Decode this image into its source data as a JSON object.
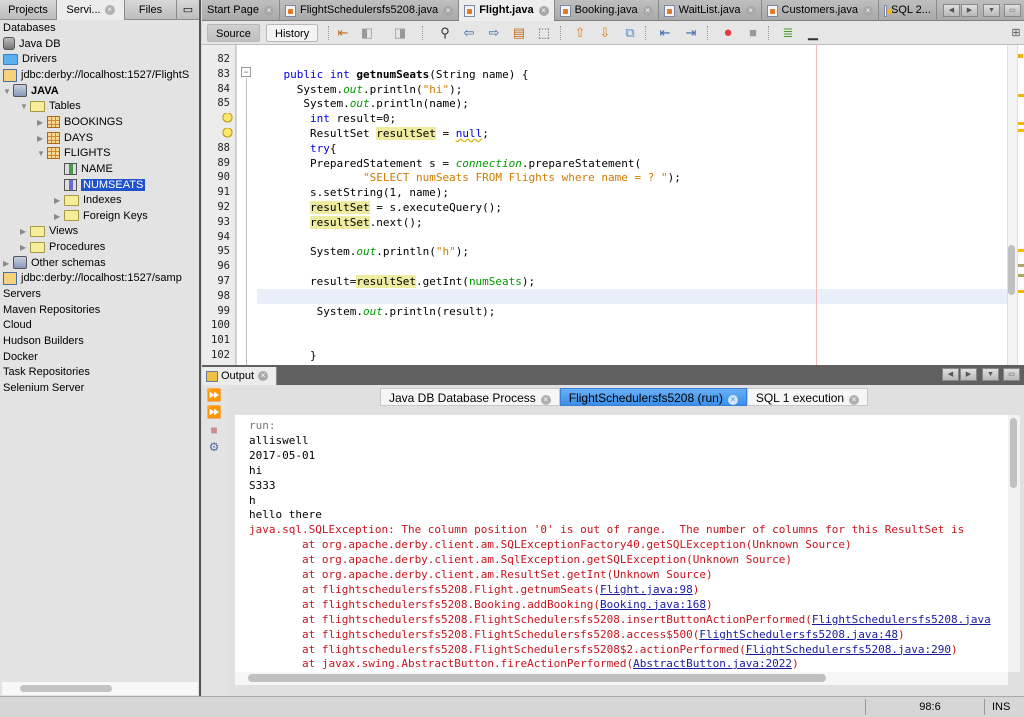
{
  "left_panel": {
    "tabs": [
      {
        "label": "Projects",
        "active": false
      },
      {
        "label": "Servi...",
        "active": true,
        "closable": true
      },
      {
        "label": "Files",
        "active": false
      }
    ],
    "minimize_icon": "window-minimize-icon",
    "tree": [
      {
        "label": "Databases",
        "level": 0,
        "icon": "none"
      },
      {
        "label": "Java DB",
        "level": 0,
        "icon": "database-server-icon"
      },
      {
        "label": "Drivers",
        "level": 0,
        "icon": "folder-icon"
      },
      {
        "label": "jdbc:derby://localhost:1527/FlightS",
        "level": 0,
        "icon": "connection-icon"
      },
      {
        "label": "JAVA",
        "level": 0,
        "icon": "schema-icon",
        "expanded": true,
        "bold": true
      },
      {
        "label": "Tables",
        "level": 1,
        "icon": "folder-icon",
        "expanded": true
      },
      {
        "label": "BOOKINGS",
        "level": 2,
        "icon": "table-icon",
        "expanded": false
      },
      {
        "label": "DAYS",
        "level": 2,
        "icon": "table-icon",
        "expanded": false
      },
      {
        "label": "FLIGHTS",
        "level": 2,
        "icon": "table-icon",
        "expanded": true
      },
      {
        "label": "NAME",
        "level": 3,
        "icon": "column-icon"
      },
      {
        "label": "NUMSEATS",
        "level": 3,
        "icon": "column-icon",
        "selected": true
      },
      {
        "label": "Indexes",
        "level": 3,
        "icon": "folder-icon",
        "expanded": false
      },
      {
        "label": "Foreign Keys",
        "level": 3,
        "icon": "folder-icon",
        "expanded": false
      },
      {
        "label": "Views",
        "level": 1,
        "icon": "folder-icon",
        "expanded": false
      },
      {
        "label": "Procedures",
        "level": 1,
        "icon": "folder-icon",
        "expanded": false
      },
      {
        "label": "Other schemas",
        "level": 0,
        "icon": "schema-icon",
        "expanded": false
      },
      {
        "label": "jdbc:derby://localhost:1527/samp",
        "level": 0,
        "icon": "connection-icon"
      },
      {
        "label": "Servers",
        "level": 0,
        "icon": "none"
      },
      {
        "label": "Maven Repositories",
        "level": 0,
        "icon": "none"
      },
      {
        "label": "Cloud",
        "level": 0,
        "icon": "none"
      },
      {
        "label": "Hudson Builders",
        "level": 0,
        "icon": "none"
      },
      {
        "label": "Docker",
        "level": 0,
        "icon": "none"
      },
      {
        "label": "Task Repositories",
        "level": 0,
        "icon": "none"
      },
      {
        "label": "Selenium Server",
        "level": 0,
        "icon": "none"
      }
    ]
  },
  "editor": {
    "tabs": [
      {
        "label": "Start Page",
        "active": false,
        "icon": "none"
      },
      {
        "label": "FlightSchedulersfs5208.java",
        "active": false,
        "icon": "java-file-icon"
      },
      {
        "label": "Flight.java",
        "active": true,
        "icon": "java-file-icon"
      },
      {
        "label": "Booking.java",
        "active": false,
        "icon": "java-file-icon"
      },
      {
        "label": "WaitList.java",
        "active": false,
        "icon": "java-file-icon"
      },
      {
        "label": "Customers.java",
        "active": false,
        "icon": "java-file-icon"
      },
      {
        "label": "SQL 2...",
        "active": false,
        "icon": "sql-file-icon"
      }
    ],
    "toolbar": {
      "source_label": "Source",
      "history_label": "History",
      "icons": [
        "last-edit-icon",
        "back-icon",
        "forward-icon",
        "find-icon",
        "find-previous-icon",
        "find-next-icon",
        "toggle-highlight-icon",
        "rectangular-selection-icon",
        "previous-bookmark-icon",
        "next-bookmark-icon",
        "toggle-bookmark-icon",
        "shift-left-icon",
        "shift-right-icon",
        "start-macro-icon",
        "stop-macro-icon",
        "comment-icon",
        "uncomment-icon"
      ],
      "split_icon": "split-window-icon"
    },
    "lines": [
      {
        "num": "82",
        "tokens": []
      },
      {
        "num": "83",
        "tokens": [
          {
            "t": "    "
          },
          {
            "t": "public int",
            "c": "kw"
          },
          {
            "t": " "
          },
          {
            "t": "getnumSeats",
            "c": "fn"
          },
          {
            "t": "(String name) {"
          }
        ]
      },
      {
        "num": "84",
        "tokens": [
          {
            "t": "      System."
          },
          {
            "t": "out",
            "c": "it"
          },
          {
            "t": ".println("
          },
          {
            "t": "\"hi\"",
            "c": "str"
          },
          {
            "t": ");"
          }
        ]
      },
      {
        "num": "85",
        "tokens": [
          {
            "t": "       System."
          },
          {
            "t": "out",
            "c": "it"
          },
          {
            "t": ".println(name);"
          }
        ]
      },
      {
        "num": "",
        "bulb": true,
        "tokens": [
          {
            "t": "        "
          },
          {
            "t": "int",
            "c": "kw"
          },
          {
            "t": " result=0;"
          }
        ]
      },
      {
        "num": "",
        "bulb": true,
        "tokens": [
          {
            "t": "        ResultSet "
          },
          {
            "t": "resultSet",
            "c": "hl"
          },
          {
            "t": " = "
          },
          {
            "t": "null",
            "c": "nul"
          },
          {
            "t": ";"
          }
        ]
      },
      {
        "num": "88",
        "tokens": [
          {
            "t": "        "
          },
          {
            "t": "try",
            "c": "kw"
          },
          {
            "t": "{"
          }
        ]
      },
      {
        "num": "89",
        "tokens": [
          {
            "t": "        PreparedStatement s = "
          },
          {
            "t": "connection",
            "c": "it"
          },
          {
            "t": ".prepareStatement("
          }
        ]
      },
      {
        "num": "90",
        "tokens": [
          {
            "t": "                "
          },
          {
            "t": "\"SELECT numSeats FROM Flights where name = ? \"",
            "c": "str"
          },
          {
            "t": ");"
          }
        ]
      },
      {
        "num": "91",
        "tokens": [
          {
            "t": "        s.setString(1, name);"
          }
        ]
      },
      {
        "num": "92",
        "tokens": [
          {
            "t": "        "
          },
          {
            "t": "resultSet",
            "c": "hl"
          },
          {
            "t": " = s.executeQuery();"
          }
        ]
      },
      {
        "num": "93",
        "tokens": [
          {
            "t": "        "
          },
          {
            "t": "resultSet",
            "c": "hl"
          },
          {
            "t": ".next();"
          }
        ]
      },
      {
        "num": "94",
        "tokens": []
      },
      {
        "num": "95",
        "tokens": [
          {
            "t": "        System."
          },
          {
            "t": "out",
            "c": "it"
          },
          {
            "t": ".println("
          },
          {
            "t": "\"h\"",
            "c": "str"
          },
          {
            "t": ");"
          }
        ]
      },
      {
        "num": "96",
        "tokens": []
      },
      {
        "num": "97",
        "tokens": [
          {
            "t": "        result="
          },
          {
            "t": "resultSet",
            "c": "hl"
          },
          {
            "t": ".getInt("
          },
          {
            "t": "numSeats",
            "c": "fld"
          },
          {
            "t": ");"
          }
        ]
      },
      {
        "num": "98",
        "current": true,
        "tokens": []
      },
      {
        "num": "99",
        "tokens": [
          {
            "t": "         System."
          },
          {
            "t": "out",
            "c": "it"
          },
          {
            "t": ".println(result);"
          }
        ]
      },
      {
        "num": "100",
        "tokens": []
      },
      {
        "num": "101",
        "tokens": []
      },
      {
        "num": "102",
        "tokens": [
          {
            "t": "        }"
          }
        ]
      }
    ]
  },
  "output": {
    "title": "Output",
    "sub_tabs": [
      {
        "label": "Java DB Database Process",
        "active": false
      },
      {
        "label": "FlightSchedulersfs5208 (run)",
        "active": true
      },
      {
        "label": "SQL 1 execution",
        "active": false
      }
    ],
    "side_icons": [
      "rerun-icon",
      "rerun-with-params-icon",
      "stop-icon",
      "settings-icon"
    ],
    "lines": [
      {
        "kind": "grey",
        "parts": [
          {
            "t": "run:"
          }
        ]
      },
      {
        "kind": "plain",
        "parts": [
          {
            "t": "alliswell"
          }
        ]
      },
      {
        "kind": "plain",
        "parts": [
          {
            "t": "2017-05-01"
          }
        ]
      },
      {
        "kind": "plain",
        "parts": [
          {
            "t": "hi"
          }
        ]
      },
      {
        "kind": "plain",
        "parts": [
          {
            "t": "S333"
          }
        ]
      },
      {
        "kind": "plain",
        "parts": [
          {
            "t": "h"
          }
        ]
      },
      {
        "kind": "plain",
        "parts": [
          {
            "t": "hello there"
          }
        ]
      },
      {
        "kind": "err",
        "parts": [
          {
            "t": "java.sql.SQLException: The column position '0' is out of range.  The number of columns for this ResultSet is"
          }
        ]
      },
      {
        "kind": "err",
        "parts": [
          {
            "t": "        at org.apache.derby.client.am.SQLExceptionFactory40.getSQLException(Unknown Source)"
          }
        ]
      },
      {
        "kind": "err",
        "parts": [
          {
            "t": "        at org.apache.derby.client.am.SqlException.getSQLException(Unknown Source)"
          }
        ]
      },
      {
        "kind": "err",
        "parts": [
          {
            "t": "        at org.apache.derby.client.am.ResultSet.getInt(Unknown Source)"
          }
        ]
      },
      {
        "kind": "err",
        "parts": [
          {
            "t": "        at flightschedulersfs5208.Flight.getnumSeats("
          },
          {
            "t": "Flight.java:98",
            "link": true
          },
          {
            "t": ")"
          }
        ]
      },
      {
        "kind": "err",
        "parts": [
          {
            "t": "        at flightschedulersfs5208.Booking.addBooking("
          },
          {
            "t": "Booking.java:168",
            "link": true
          },
          {
            "t": ")"
          }
        ]
      },
      {
        "kind": "err",
        "parts": [
          {
            "t": "        at flightschedulersfs5208.FlightSchedulersfs5208.insertButtonActionPerformed("
          },
          {
            "t": "FlightSchedulersfs5208.java",
            "link": true
          }
        ]
      },
      {
        "kind": "err",
        "parts": [
          {
            "t": "        at flightschedulersfs5208.FlightSchedulersfs5208.access$500("
          },
          {
            "t": "FlightSchedulersfs5208.java:48",
            "link": true
          },
          {
            "t": ")"
          }
        ]
      },
      {
        "kind": "err",
        "parts": [
          {
            "t": "        at flightschedulersfs5208.FlightSchedulersfs5208$2.actionPerformed("
          },
          {
            "t": "FlightSchedulersfs5208.java:290",
            "link": true
          },
          {
            "t": ")"
          }
        ]
      },
      {
        "kind": "err",
        "parts": [
          {
            "t": "        at javax.swing.AbstractButton.fireActionPerformed("
          },
          {
            "t": "AbstractButton.java:2022",
            "link": true
          },
          {
            "t": ")"
          }
        ]
      }
    ]
  },
  "status_bar": {
    "caret_position": "98:6",
    "insert_mode": "INS"
  }
}
